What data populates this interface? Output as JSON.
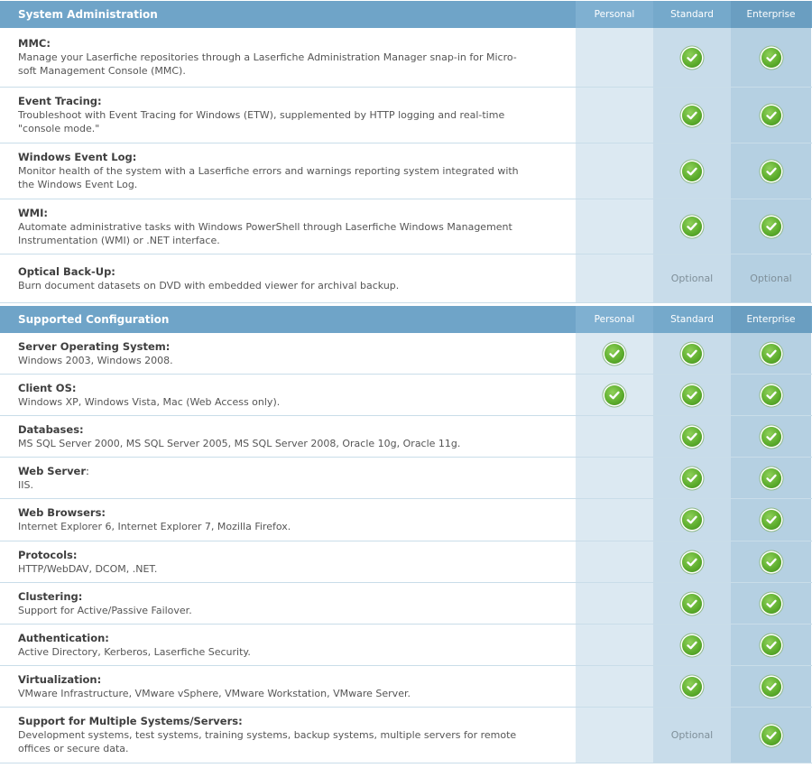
{
  "columns": [
    "Personal",
    "Standard",
    "Enterprise"
  ],
  "sections": [
    {
      "title": "System Administration",
      "rows": [
        {
          "name": "MMC:",
          "name_suffix": "",
          "desc": [
            "Manage your Laserfiche repositories through a Laserfiche Administration Manager snap-in for Micro-",
            "soft Management Console (MMC)."
          ],
          "personal": "",
          "standard": "check",
          "enterprise": "check"
        },
        {
          "name": "Event Tracing:",
          "name_suffix": "",
          "desc": [
            "Troubleshoot with Event Tracing for Windows (ETW), supplemented by HTTP logging and real-time",
            "\"console mode.\""
          ],
          "personal": "",
          "standard": "check",
          "enterprise": "check"
        },
        {
          "name": "Windows Event Log:",
          "name_suffix": "",
          "desc": [
            "Monitor health of the system with a Laserfiche errors and warnings reporting system integrated with",
            "the Windows Event Log."
          ],
          "personal": "",
          "standard": "check",
          "enterprise": "check"
        },
        {
          "name": "WMI:",
          "name_suffix": "",
          "desc": [
            "Automate administrative tasks with Windows PowerShell through Laserfiche Windows Management",
            "Instrumentation (WMI) or .NET interface."
          ],
          "personal": "",
          "standard": "check",
          "enterprise": "check"
        },
        {
          "name": "Optical Back-Up:",
          "name_suffix": "",
          "desc": [
            "Burn document datasets on DVD with embedded viewer for archival backup."
          ],
          "personal": "",
          "standard": "Optional",
          "enterprise": "Optional"
        }
      ]
    },
    {
      "title": "Supported Configuration",
      "rows": [
        {
          "name": "Server Operating System:",
          "name_suffix": "",
          "desc": [
            "Windows 2003, Windows 2008."
          ],
          "personal": "check",
          "standard": "check",
          "enterprise": "check"
        },
        {
          "name": "Client OS:",
          "name_suffix": "",
          "desc": [
            "Windows XP, Windows Vista, Mac (Web Access only)."
          ],
          "personal": "check",
          "standard": "check",
          "enterprise": "check"
        },
        {
          "name": "Databases:",
          "name_suffix": "",
          "desc": [
            "MS SQL Server 2000, MS SQL Server 2005, MS SQL Server 2008, Oracle 10g, Oracle 11g."
          ],
          "personal": "",
          "standard": "check",
          "enterprise": "check"
        },
        {
          "name": "Web Server",
          "name_suffix": ":",
          "desc": [
            "IIS."
          ],
          "personal": "",
          "standard": "check",
          "enterprise": "check"
        },
        {
          "name": "Web Browsers:",
          "name_suffix": "",
          "desc": [
            "Internet Explorer 6, Internet Explorer 7, Mozilla Firefox."
          ],
          "personal": "",
          "standard": "check",
          "enterprise": "check"
        },
        {
          "name": "Protocols:",
          "name_suffix": "",
          "desc": [
            "HTTP/WebDAV, DCOM, .NET."
          ],
          "personal": "",
          "standard": "check",
          "enterprise": "check"
        },
        {
          "name": "Clustering:",
          "name_suffix": "",
          "desc": [
            "Support for Active/Passive Failover."
          ],
          "personal": "",
          "standard": "check",
          "enterprise": "check"
        },
        {
          "name": "Authentication:",
          "name_suffix": "",
          "desc": [
            "Active Directory, Kerberos, Laserfiche Security."
          ],
          "personal": "",
          "standard": "check",
          "enterprise": "check"
        },
        {
          "name": "Virtualization:",
          "name_suffix": "",
          "desc": [
            "VMware Infrastructure, VMware vSphere, VMware Workstation, VMware Server."
          ],
          "personal": "",
          "standard": "check",
          "enterprise": "check"
        },
        {
          "name": "Support for Multiple Systems/Servers:",
          "name_suffix": "",
          "desc": [
            "Development systems, test systems, training systems, backup systems, multiple servers for remote",
            "offices or secure data."
          ],
          "personal": "",
          "standard": "Optional",
          "enterprise": "check"
        }
      ]
    }
  ]
}
